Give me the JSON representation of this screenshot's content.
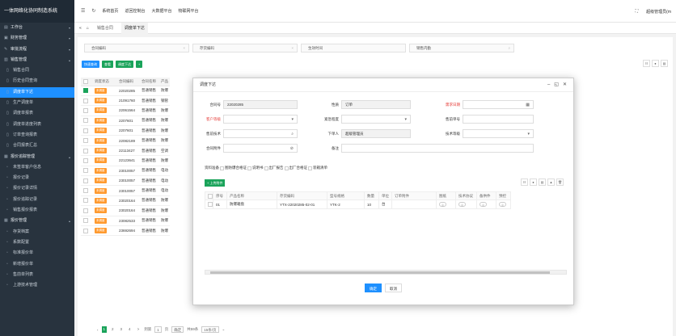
{
  "app": {
    "title": "一体网络化协同制造系统"
  },
  "sidebar": {
    "items": [
      {
        "icon": "home-icon",
        "label": "工作台"
      },
      {
        "icon": "finance-icon",
        "label": "财务管理"
      },
      {
        "icon": "approve-icon",
        "label": "审批流程"
      },
      {
        "icon": "sales-icon",
        "label": "销售管理"
      },
      {
        "icon": "doc-icon",
        "label": "销售合同"
      },
      {
        "icon": "doc-icon",
        "label": "历史合同查询"
      },
      {
        "icon": "doc-icon",
        "label": "调度单下达"
      },
      {
        "icon": "doc-icon",
        "label": "生产调度单"
      },
      {
        "icon": "doc-icon",
        "label": "调度单报表"
      },
      {
        "icon": "doc-icon",
        "label": "调度单进度列表"
      },
      {
        "icon": "doc-icon",
        "label": "订单查询报表"
      },
      {
        "icon": "doc-icon",
        "label": "合同报表汇总"
      },
      {
        "icon": "track-icon",
        "label": "报价追踪管理"
      },
      {
        "icon": "list-icon",
        "label": "未签单客户信息"
      },
      {
        "icon": "list-icon",
        "label": "报价记录"
      },
      {
        "icon": "list-icon",
        "label": "报价记录详情"
      },
      {
        "icon": "list-icon",
        "label": "报价追踪记录"
      },
      {
        "icon": "list-icon",
        "label": "销售报价报表"
      },
      {
        "icon": "price-icon",
        "label": "报价管理"
      },
      {
        "icon": "list-icon",
        "label": "存货档案"
      },
      {
        "icon": "list-icon",
        "label": "系数配置"
      },
      {
        "icon": "list-icon",
        "label": "标准报价单"
      },
      {
        "icon": "list-icon",
        "label": "新增报价单"
      },
      {
        "icon": "list-icon",
        "label": "售前单列表"
      },
      {
        "icon": "list-icon",
        "label": "上游技术管理"
      }
    ]
  },
  "topbar": {
    "items": [
      "系统首页",
      "返回控制台",
      "大数据平台",
      "物联网平台"
    ],
    "user": "超级管理员(m"
  },
  "tabs": {
    "items": [
      "销售合同",
      "调度单下达"
    ]
  },
  "filters": {
    "contract_no": "合同编码",
    "stock_code": "存货编码",
    "create_time": "生效时间",
    "sales_dept": "销售内勤"
  },
  "toolbar": {
    "search": "快速查询",
    "view": "查看",
    "dispatch": "调度下达",
    "add": "+"
  },
  "table": {
    "headers": [
      "",
      "调度状态",
      "合同编码",
      "合同名称",
      "产品"
    ],
    "rows": [
      {
        "status": "未调度",
        "code": "22020285",
        "type": "普通销售",
        "prod": "防爆"
      },
      {
        "status": "未调度",
        "code": "21091760",
        "type": "普通销售",
        "prod": "钢管"
      },
      {
        "status": "未调度",
        "code": "22061564",
        "type": "普通销售",
        "prod": "防爆"
      },
      {
        "status": "未调度",
        "code": "2207601",
        "type": "普通销售",
        "prod": "防爆"
      },
      {
        "status": "未调度",
        "code": "2207601",
        "type": "普通销售",
        "prod": "防爆"
      },
      {
        "status": "未调度",
        "code": "22082189",
        "type": "普通销售",
        "prod": "防爆"
      },
      {
        "status": "未调度",
        "code": "22113427",
        "type": "普通销售",
        "prod": "空调"
      },
      {
        "status": "未调度",
        "code": "22123641",
        "type": "普通销售",
        "prod": "防爆"
      },
      {
        "status": "未调度",
        "code": "23010057",
        "type": "普通销售",
        "prod": "电动"
      },
      {
        "status": "未调度",
        "code": "23010057",
        "type": "普通销售",
        "prod": "电动"
      },
      {
        "status": "未调度",
        "code": "23010057",
        "type": "普通销售",
        "prod": "电动"
      },
      {
        "status": "未调度",
        "code": "23020164",
        "type": "普通销售",
        "prod": "防爆"
      },
      {
        "status": "未调度",
        "code": "23020164",
        "type": "普通销售",
        "prod": "防爆"
      },
      {
        "status": "未调度",
        "code": "23082533",
        "type": "普通销售",
        "prod": "防爆"
      },
      {
        "status": "未调度",
        "code": "23692694",
        "type": "普通销售",
        "prod": "防爆"
      }
    ]
  },
  "pager": {
    "pages": [
      "1",
      "2",
      "3",
      "4"
    ],
    "next": ">",
    "goto": "到第",
    "page_input": "1",
    "page_unit": "页",
    "confirm": "确定",
    "total": "共59条",
    "per_page": "15条/页"
  },
  "dialog": {
    "title": "调度下达",
    "fields": {
      "contract_no_label": "合同号",
      "contract_no": "22020285",
      "nature_label": "性质",
      "nature": "订单",
      "due_date_label": "需求日期",
      "customer_label": "客户等级",
      "urgency_label": "紧急程度",
      "prev_no_label": "售前单号",
      "pre_tech_label": "售前技术",
      "issuer_label": "下单人",
      "issuer": "超级管理员",
      "tech_level_label": "技术等级",
      "attach_label": "合同附件",
      "note_label": "备注"
    },
    "checks": {
      "label": "资料准备",
      "items": [
        "图防爆合格证",
        "说明书",
        "出厂报告",
        "出厂合格证",
        "装箱清单"
      ]
    },
    "add_btn": "+ 上传附件",
    "sub_table": {
      "headers": [
        "",
        "序号",
        "产品名称",
        "存货编码",
        "型号规格",
        "数量",
        "单位",
        "订单附件",
        "图纸",
        "技术协议",
        "备供件",
        "预控"
      ],
      "rows": [
        {
          "no": "01",
          "name": "防爆箱盘",
          "code": "YTX-22020285-02-01",
          "spec": "YTK-2",
          "qty": "10",
          "unit": "台"
        }
      ]
    },
    "ok": "确定",
    "cancel": "取消"
  }
}
